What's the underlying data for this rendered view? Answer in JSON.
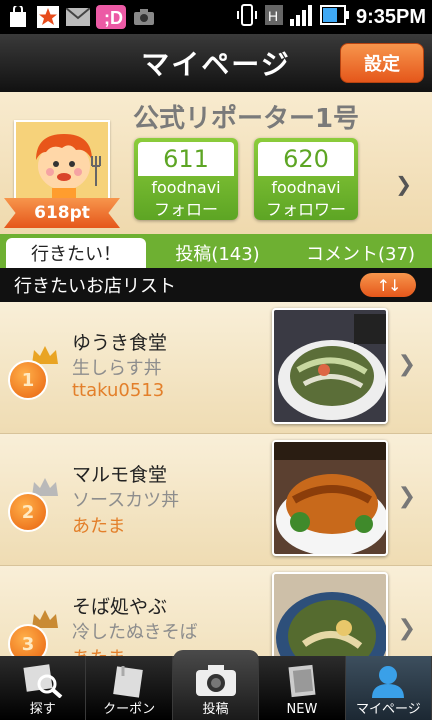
{
  "status_bar": {
    "time": "9:35PM",
    "notification_icons": [
      "shopping-bag-icon",
      "star-icon",
      "mail-icon",
      "d-app-icon",
      "camera-icon"
    ]
  },
  "header": {
    "title": "マイページ",
    "settings_label": "設定"
  },
  "profile": {
    "name": "公式リポーター1号",
    "points": "618pt",
    "following": {
      "count": "611",
      "label_line1": "foodnavi",
      "label_line2": "フォロー"
    },
    "followers": {
      "count": "620",
      "label_line1": "foodnavi",
      "label_line2": "フォロワー"
    }
  },
  "tabs": [
    {
      "label": "行きたい！",
      "active": true
    },
    {
      "label": "投稿(143)",
      "active": false
    },
    {
      "label": "コメント(37)",
      "active": false
    }
  ],
  "list": {
    "title": "行きたいお店リスト",
    "sort_label": "↑↓",
    "items": [
      {
        "rank": "1",
        "shop": "ゆうき食堂",
        "dish": "生しらす丼",
        "user": "ttaku0513",
        "crown_color": "#e9a423"
      },
      {
        "rank": "2",
        "shop": "マルモ食堂",
        "dish": "ソースカツ丼",
        "user": "あたま",
        "crown_color": "#b9b9b9"
      },
      {
        "rank": "3",
        "shop": "そば処やぶ",
        "dish": "冷したぬきそば",
        "user": "あたま",
        "crown_color": "#c98a33"
      }
    ]
  },
  "bottom_nav": [
    {
      "label": "探す",
      "icon": "search-icon"
    },
    {
      "label": "クーポン",
      "icon": "coupon-icon"
    },
    {
      "label": "投稿",
      "icon": "camera-icon"
    },
    {
      "label": "NEW",
      "icon": "new-icon"
    },
    {
      "label": "マイページ",
      "icon": "person-icon"
    }
  ]
}
